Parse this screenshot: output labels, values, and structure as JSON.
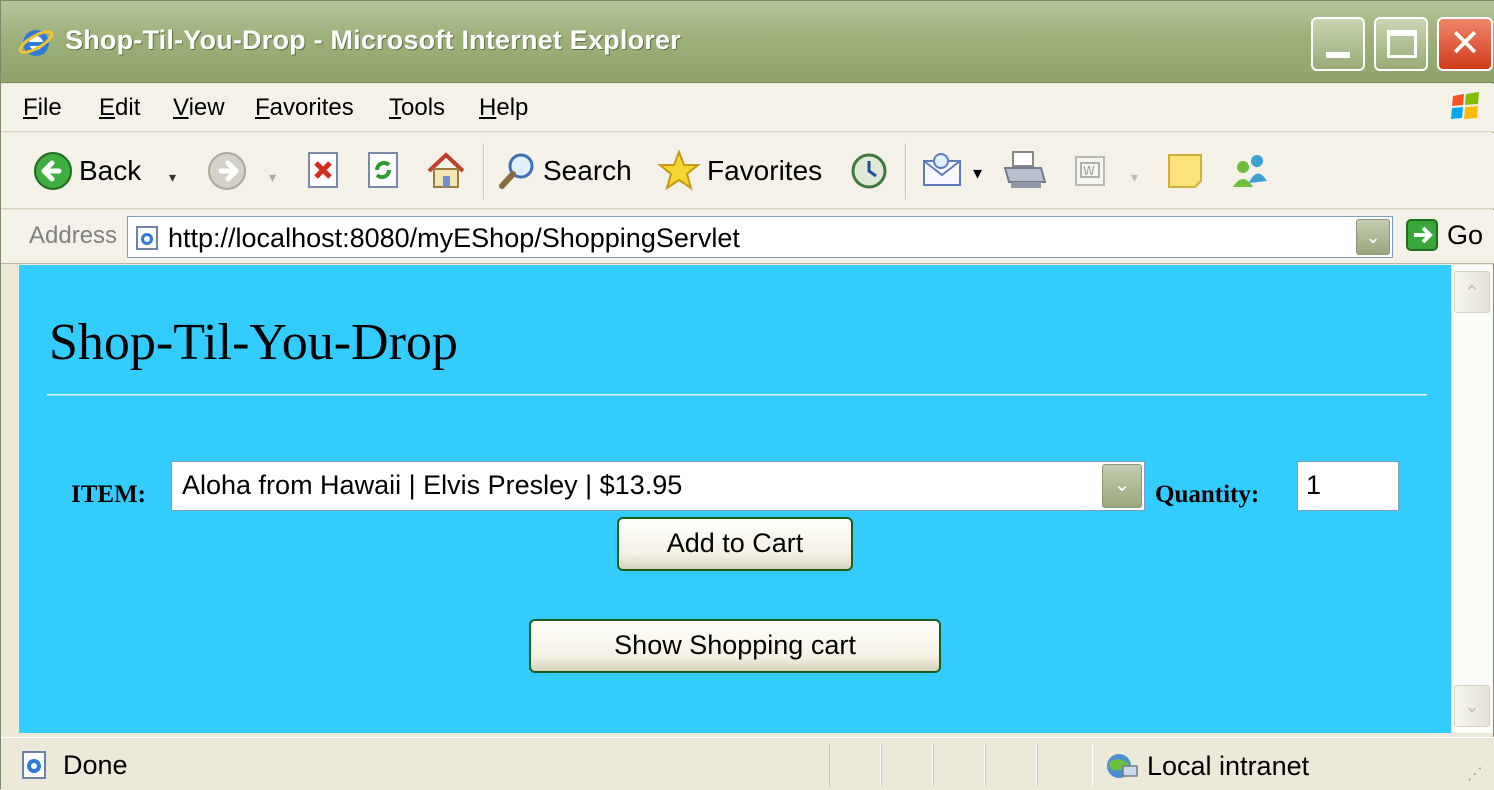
{
  "window": {
    "title": "Shop-Til-You-Drop - Microsoft Internet Explorer"
  },
  "menu": {
    "items": [
      "File",
      "Edit",
      "View",
      "Favorites",
      "Tools",
      "Help"
    ]
  },
  "toolbar": {
    "back_label": "Back",
    "search_label": "Search",
    "favorites_label": "Favorites"
  },
  "address": {
    "label": "Address",
    "url": "http://localhost:8080/myEShop/ShoppingServlet",
    "go_label": "Go"
  },
  "page": {
    "background_color": "#33ccff",
    "heading": "Shop-Til-You-Drop",
    "item_label": "ITEM:",
    "item_selected": "Aloha from Hawaii | Elvis Presley | $13.95",
    "quantity_label": "Quantity:",
    "quantity_value": "1",
    "add_button": "Add to Cart",
    "show_button": "Show Shopping cart"
  },
  "status": {
    "text": "Done",
    "zone": "Local intranet"
  }
}
